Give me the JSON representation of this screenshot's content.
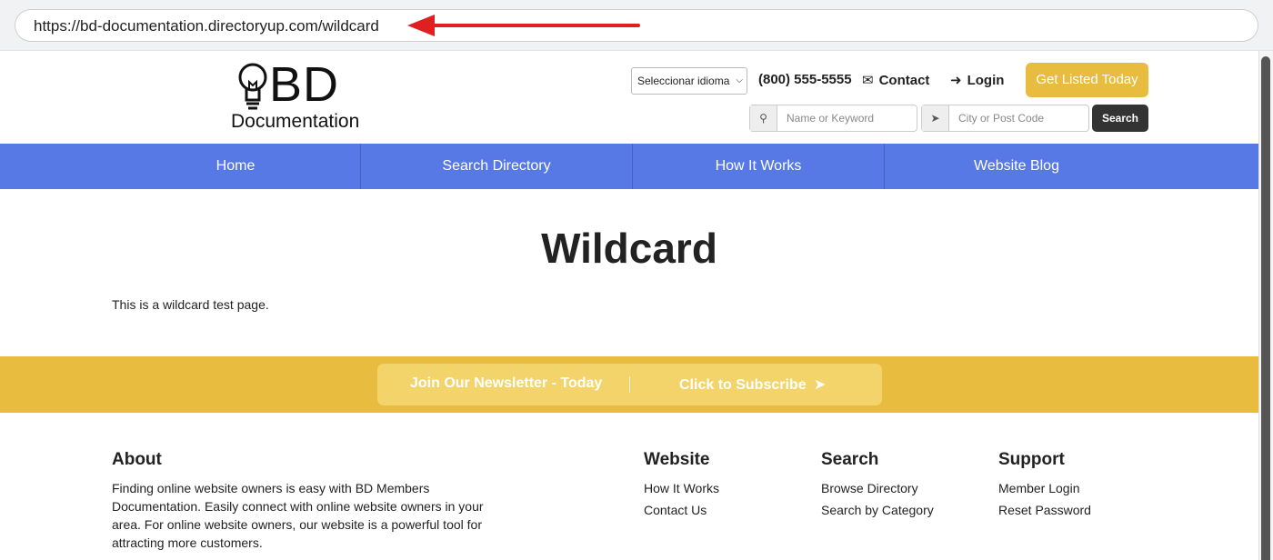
{
  "browser": {
    "url": "https://bd-documentation.directoryup.com/wildcard"
  },
  "colors": {
    "nav_bg": "#5679e6",
    "accent_yellow": "#e8bd3f",
    "annotation_arrow": "#e02020",
    "search_button_bg": "#333333"
  },
  "header": {
    "logo_main": "BD",
    "logo_sub": "Documentation",
    "logo_icon": "lightbulb-icon",
    "language_select": "Seleccionar idioma",
    "phone": "(800) 555-5555",
    "contact_label": "Contact",
    "contact_icon": "envelope-icon",
    "login_label": "Login",
    "login_icon": "sign-in-icon",
    "cta_label": "Get Listed Today",
    "keyword_placeholder": "Name or Keyword",
    "keyword_icon": "search-icon",
    "location_placeholder": "City or Post Code",
    "location_icon": "location-arrow-icon",
    "search_label": "Search"
  },
  "nav": {
    "items": [
      {
        "label": "Home"
      },
      {
        "label": "Search Directory"
      },
      {
        "label": "How It Works"
      },
      {
        "label": "Website Blog"
      }
    ]
  },
  "main": {
    "title": "Wildcard",
    "body": "This is a wildcard test page."
  },
  "newsletter": {
    "left_label": "Join Our Newsletter - Today",
    "right_label": "Click to Subscribe",
    "right_icon": "chevron-circle-right-icon"
  },
  "footer": {
    "about": {
      "heading": "About",
      "text": "Finding online website owners is easy with BD Members Documentation. Easily connect with online website owners in your area. For online website owners, our website is a powerful tool for attracting more customers."
    },
    "website": {
      "heading": "Website",
      "links": [
        "How It Works",
        "Contact Us"
      ]
    },
    "search": {
      "heading": "Search",
      "links": [
        "Browse Directory",
        "Search by Category"
      ]
    },
    "support": {
      "heading": "Support",
      "links": [
        "Member Login",
        "Reset Password"
      ]
    }
  }
}
